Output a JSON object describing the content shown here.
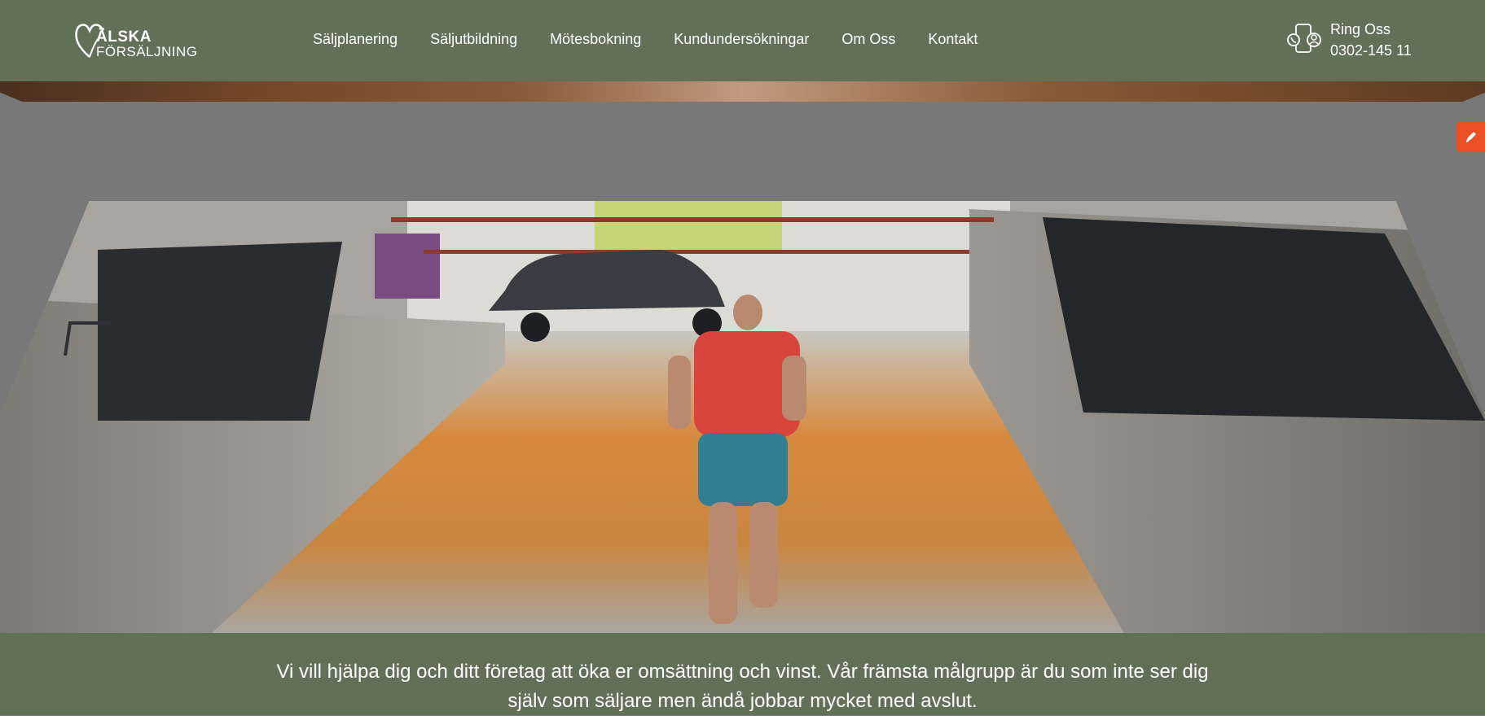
{
  "header": {
    "logo": {
      "line1": "ÄLSKA",
      "line2": "FÖRSÄLJNING"
    },
    "nav": [
      {
        "label": "Säljplanering"
      },
      {
        "label": "Säljutbildning"
      },
      {
        "label": "Mötesbokning"
      },
      {
        "label": "Kundundersökningar"
      },
      {
        "label": "Om Oss"
      },
      {
        "label": "Kontakt"
      }
    ],
    "contact": {
      "icon": "phone-contact-icon",
      "label": "Ring Oss",
      "phone": "0302-145 11"
    }
  },
  "side_tab": {
    "icon": "pencil-icon",
    "color": "#ec4f24"
  },
  "hero": {
    "image": "runner-in-parking-garage"
  },
  "mission": {
    "text": "Vi vill hjälpa dig och ditt företag att öka er omsättning och vinst. Vår främsta målgrupp är du som inte ser dig själv som säljare men ändå jobbar mycket med avslut."
  },
  "colors": {
    "header_bg": "#607158",
    "mission_bg": "#607158",
    "page_bg": "#787878"
  }
}
